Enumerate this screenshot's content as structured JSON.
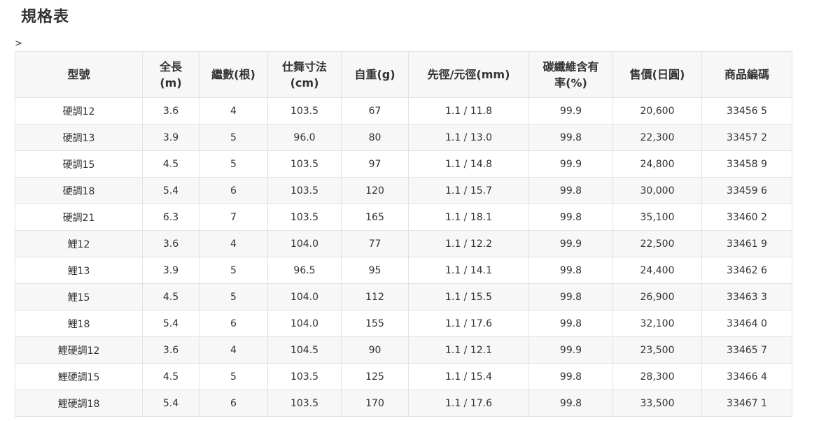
{
  "page": {
    "title": "規格表",
    "stray_mark": ">"
  },
  "table": {
    "headers": [
      "型號",
      "全長\n(m)",
      "繼數(根)",
      "仕舞寸法\n(cm)",
      "自重(g)",
      "先徑/元徑(mm)",
      "碳纖維含有\n率(%)",
      "售價(日圓)",
      "商品編碼"
    ],
    "rows": [
      [
        "硬調12",
        "3.6",
        "4",
        "103.5",
        "67",
        "1.1 / 11.8",
        "99.9",
        "20,600",
        "33456 5"
      ],
      [
        "硬調13",
        "3.9",
        "5",
        "96.0",
        "80",
        "1.1 / 13.0",
        "99.8",
        "22,300",
        "33457 2"
      ],
      [
        "硬調15",
        "4.5",
        "5",
        "103.5",
        "97",
        "1.1 / 14.8",
        "99.9",
        "24,800",
        "33458 9"
      ],
      [
        "硬調18",
        "5.4",
        "6",
        "103.5",
        "120",
        "1.1 / 15.7",
        "99.8",
        "30,000",
        "33459 6"
      ],
      [
        "硬調21",
        "6.3",
        "7",
        "103.5",
        "165",
        "1.1 / 18.1",
        "99.8",
        "35,100",
        "33460 2"
      ],
      [
        "鯉12",
        "3.6",
        "4",
        "104.0",
        "77",
        "1.1 / 12.2",
        "99.9",
        "22,500",
        "33461 9"
      ],
      [
        "鯉13",
        "3.9",
        "5",
        "96.5",
        "95",
        "1.1 / 14.1",
        "99.8",
        "24,400",
        "33462 6"
      ],
      [
        "鯉15",
        "4.5",
        "5",
        "104.0",
        "112",
        "1.1 / 15.5",
        "99.8",
        "26,900",
        "33463 3"
      ],
      [
        "鯉18",
        "5.4",
        "6",
        "104.0",
        "155",
        "1.1 / 17.6",
        "99.8",
        "32,100",
        "33464 0"
      ],
      [
        "鯉硬調12",
        "3.6",
        "4",
        "104.5",
        "90",
        "1.1 / 12.1",
        "99.9",
        "23,500",
        "33465 7"
      ],
      [
        "鯉硬調15",
        "4.5",
        "5",
        "103.5",
        "125",
        "1.1 / 15.4",
        "99.8",
        "28,300",
        "33466 4"
      ],
      [
        "鯉硬調18",
        "5.4",
        "6",
        "103.5",
        "170",
        "1.1 / 17.6",
        "99.8",
        "33,500",
        "33467 1"
      ]
    ]
  }
}
